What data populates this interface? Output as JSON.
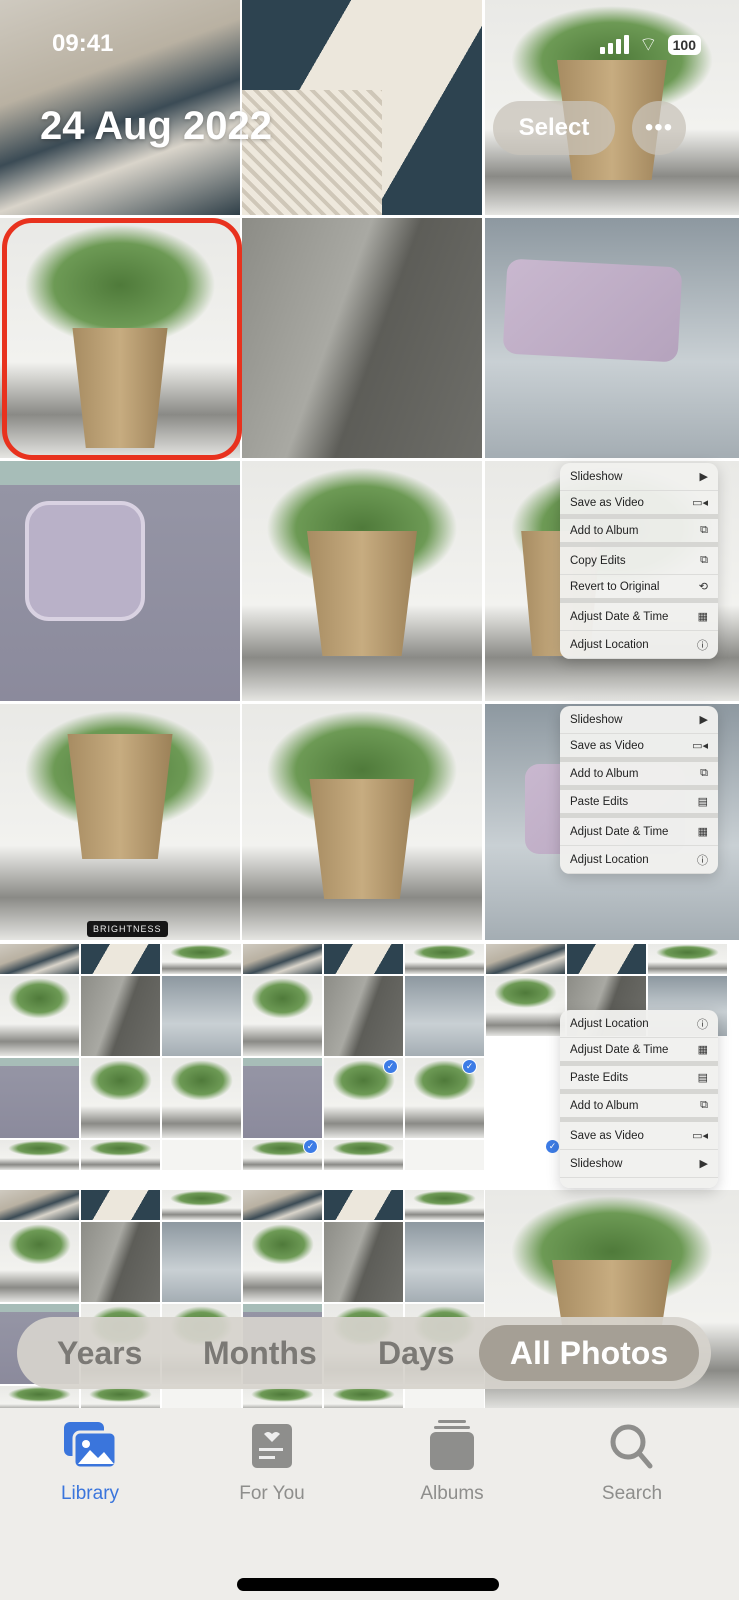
{
  "status_bar": {
    "time": "09:41",
    "battery": "100"
  },
  "header": {
    "date_title": "24 Aug 2022",
    "select_label": "Select",
    "more_label": "•••"
  },
  "overlay": {
    "brightness_label": "BRIGHTNESS"
  },
  "menus": {
    "menu_a": [
      {
        "label": "Slideshow",
        "icon": "play-icon",
        "glyph": "▶"
      },
      {
        "label": "Save as Video",
        "icon": "video-icon",
        "glyph": "▭◂"
      },
      {
        "label": "Add to Album",
        "icon": "add-album-icon",
        "glyph": "⧉"
      },
      {
        "label": "Copy Edits",
        "icon": "copy-edits-icon",
        "glyph": "⧉"
      },
      {
        "label": "Revert to Original",
        "icon": "revert-icon",
        "glyph": "⟲"
      },
      {
        "label": "Adjust Date & Time",
        "icon": "calendar-icon",
        "glyph": "▦"
      },
      {
        "label": "Adjust Location",
        "icon": "location-icon",
        "glyph": "ⓘ"
      }
    ],
    "menu_b": [
      {
        "label": "Slideshow",
        "icon": "play-icon",
        "glyph": "▶"
      },
      {
        "label": "Save as Video",
        "icon": "video-icon",
        "glyph": "▭◂"
      },
      {
        "label": "Add to Album",
        "icon": "add-album-icon",
        "glyph": "⧉"
      },
      {
        "label": "Paste Edits",
        "icon": "paste-edits-icon",
        "glyph": "▤"
      },
      {
        "label": "Adjust Date & Time",
        "icon": "calendar-icon",
        "glyph": "▦"
      },
      {
        "label": "Adjust Location",
        "icon": "location-icon",
        "glyph": "ⓘ"
      }
    ],
    "menu_c": [
      {
        "label": "Adjust Location",
        "icon": "location-icon",
        "glyph": "ⓘ"
      },
      {
        "label": "Adjust Date & Time",
        "icon": "calendar-icon",
        "glyph": "▦"
      },
      {
        "label": "Paste Edits",
        "icon": "paste-edits-icon",
        "glyph": "▤"
      },
      {
        "label": "Add to Album",
        "icon": "add-album-icon",
        "glyph": "⧉"
      },
      {
        "label": "Save as Video",
        "icon": "video-icon",
        "glyph": "▭◂"
      },
      {
        "label": "Slideshow",
        "icon": "play-icon",
        "glyph": "▶"
      }
    ]
  },
  "segmented": {
    "options": [
      "Years",
      "Months",
      "Days",
      "All Photos"
    ],
    "selected": "All Photos"
  },
  "tabs": [
    {
      "label": "Library",
      "active": true
    },
    {
      "label": "For You",
      "active": false
    },
    {
      "label": "Albums",
      "active": false
    },
    {
      "label": "Search",
      "active": false
    }
  ],
  "colors": {
    "accent": "#3a75dc",
    "highlight": "#e8321e",
    "check": "#3d7ce6"
  }
}
